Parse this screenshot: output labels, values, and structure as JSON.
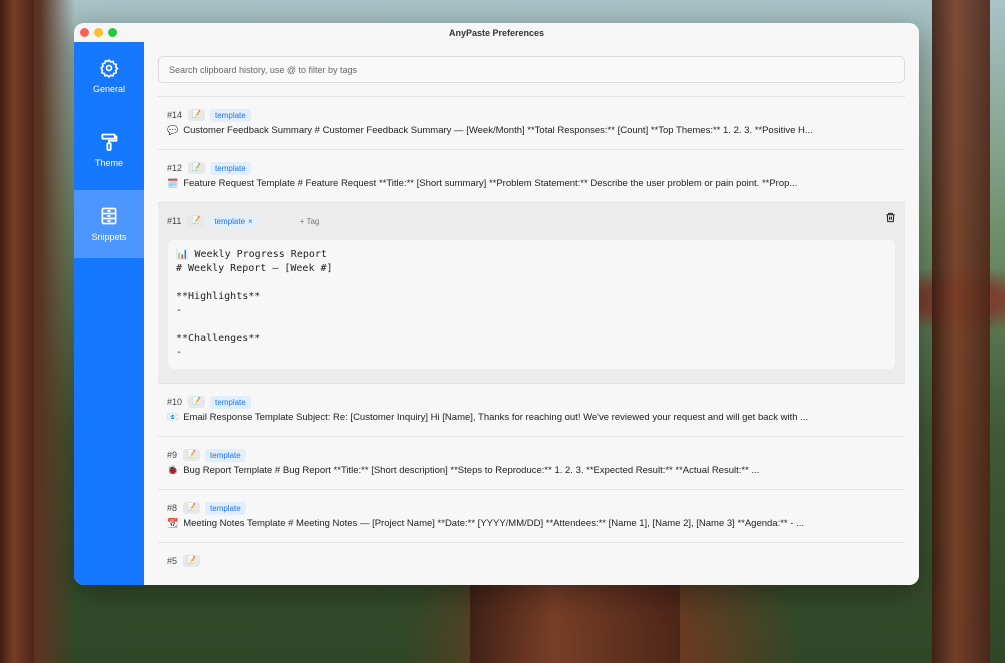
{
  "window": {
    "title": "AnyPaste Preferences"
  },
  "sidebar": {
    "items": [
      {
        "label": "General",
        "icon": "gear-icon",
        "active": false
      },
      {
        "label": "Theme",
        "icon": "paint-roller-icon",
        "active": false
      },
      {
        "label": "Snippets",
        "icon": "cabinet-icon",
        "active": true
      }
    ]
  },
  "search": {
    "placeholder": "Search clipboard history, use @ to filter by tags"
  },
  "snippets": [
    {
      "num": "#14",
      "tag": "template",
      "icon": "💬",
      "text": "Customer Feedback Summary # Customer Feedback Summary — [Week/Month] **Total Responses:** [Count] **Top Themes:** 1. 2. 3. **Positive H..."
    },
    {
      "num": "#12",
      "tag": "template",
      "icon": "🗓️",
      "text": "Feature Request Template # Feature Request **Title:** [Short summary] **Problem Statement:** Describe the user problem or pain point. **Prop..."
    },
    {
      "num": "#11",
      "tag": "template",
      "tag_remove": "×",
      "add_tag": "+ Tag",
      "lines": [
        "📊 Weekly Progress Report",
        "# Weekly Report — [Week #]",
        "",
        "**Highlights**",
        "-",
        "",
        "**Challenges**",
        "-"
      ]
    },
    {
      "num": "#10",
      "tag": "template",
      "icon": "📧",
      "text": "Email Response Template Subject: Re: [Customer Inquiry] Hi [Name], Thanks for reaching out! We've reviewed your request and will get back with ..."
    },
    {
      "num": "#9",
      "tag": "template",
      "icon": "🐞",
      "text": "Bug Report Template # Bug Report **Title:** [Short description] **Steps to Reproduce:** 1. 2. 3. **Expected Result:** **Actual Result:** ..."
    },
    {
      "num": "#8",
      "tag": "template",
      "icon": "📆",
      "text": "Meeting Notes Template # Meeting Notes — [Project Name] **Date:** [YYYY/MM/DD] **Attendees:** [Name 1], [Name 2], [Name 3] **Agenda:** - ..."
    },
    {
      "num": "#5"
    }
  ],
  "colors": {
    "accent": "#1677ff",
    "sidebar_active": "#4e96ff",
    "tag_bg": "#e3eefc"
  }
}
